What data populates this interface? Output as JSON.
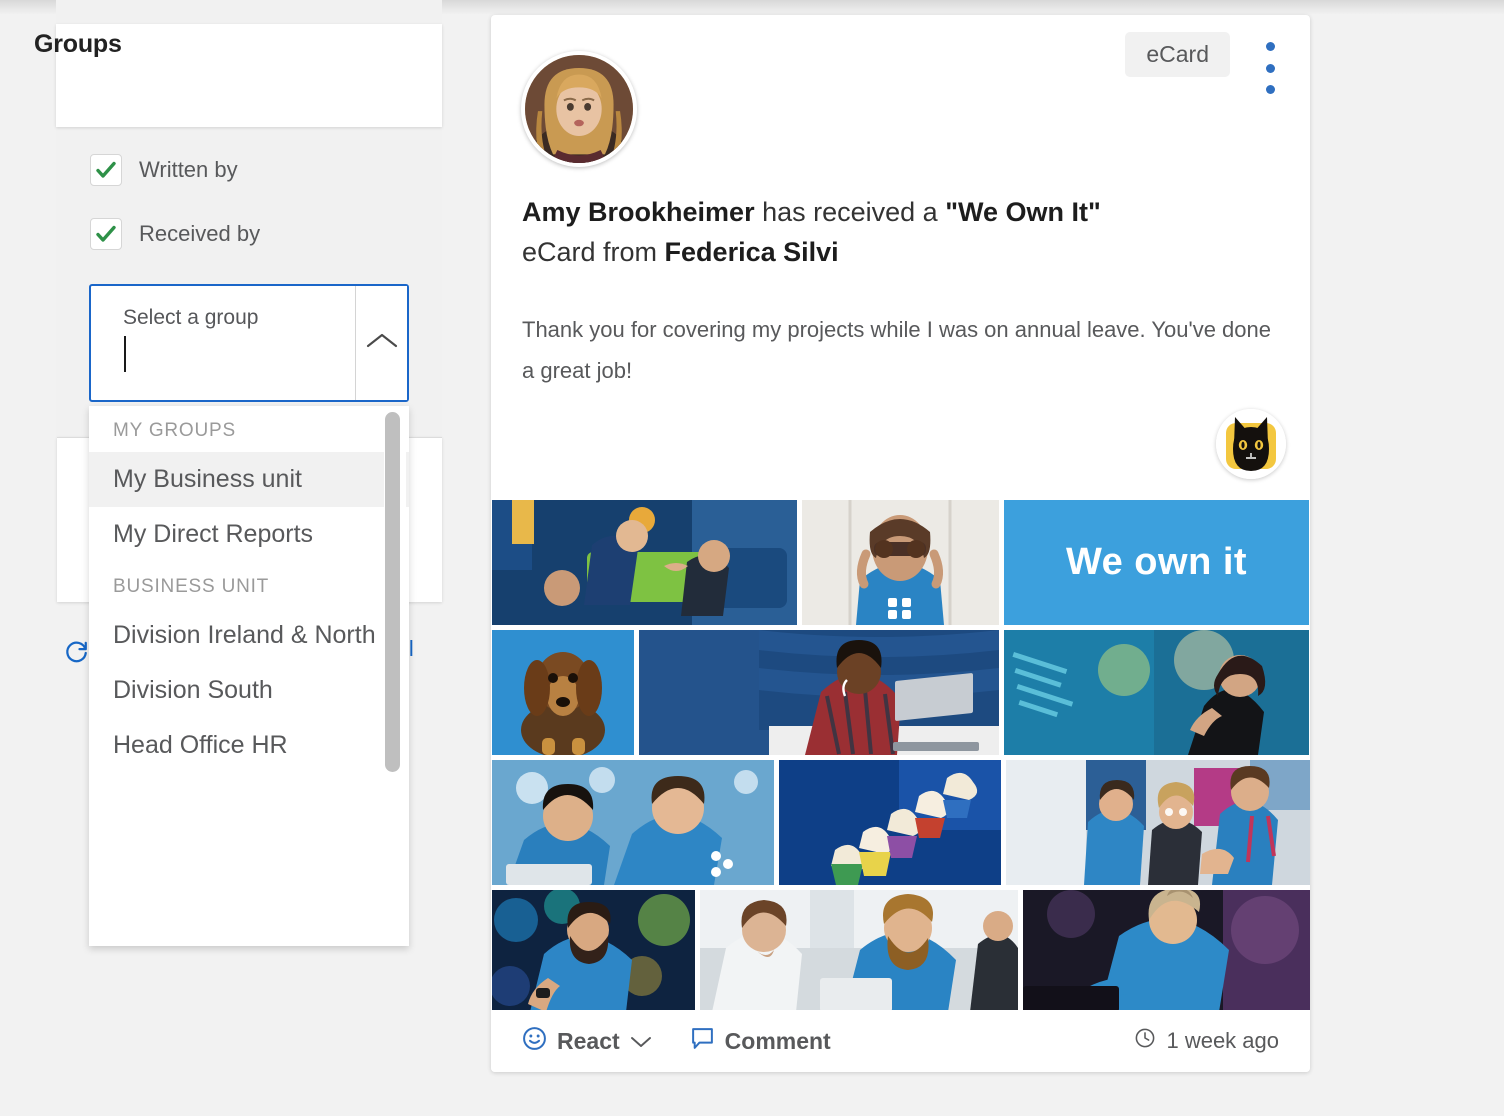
{
  "sidebar": {
    "title": "Groups",
    "checkboxes": [
      {
        "label": "Written by",
        "checked": true
      },
      {
        "label": "Received by",
        "checked": true
      }
    ],
    "select": {
      "placeholder": "Select a group",
      "value": "",
      "toggle_icon": "chevron-up-icon"
    },
    "dropdown": {
      "sections": [
        {
          "header": "MY GROUPS",
          "items": [
            {
              "label": "My Business unit",
              "selected": true
            },
            {
              "label": "My Direct Reports",
              "selected": false
            }
          ]
        },
        {
          "header": "BUSINESS UNIT",
          "items": [
            {
              "label": "Division Ireland & North",
              "selected": false
            },
            {
              "label": "Division South",
              "selected": false
            },
            {
              "label": "Head Office HR",
              "selected": false
            }
          ]
        }
      ]
    },
    "behind": {
      "refresh_icon": "refresh-icon",
      "truncated_link": "il"
    }
  },
  "post": {
    "badge": "eCard",
    "menu_icon": "kebab-menu-icon",
    "avatar_name": "Amy Brookheimer",
    "title": {
      "recipient": "Amy Brookheimer",
      "mid1": " has received a ",
      "card_name": "\"We Own It\"",
      "mid2": "eCard from ",
      "sender": "Federica Silvi"
    },
    "body": "Thank you for covering my projects while I was on annual leave. You've done a great job!",
    "reaction_badge_icon": "black-cat-icon",
    "collage_caption": "We own it",
    "footer": {
      "react_label": "React",
      "react_icon": "smiley-icon",
      "react_chevron": "chevron-down-icon",
      "comment_label": "Comment",
      "comment_icon": "speech-bubble-icon",
      "time_icon": "clock-icon",
      "timestamp": "1 week ago"
    }
  },
  "colors": {
    "accent_blue": "#1a66c9",
    "check_green": "#2e9148",
    "banner_blue": "#3ca0dd",
    "page_bg": "#f2f2f2"
  }
}
